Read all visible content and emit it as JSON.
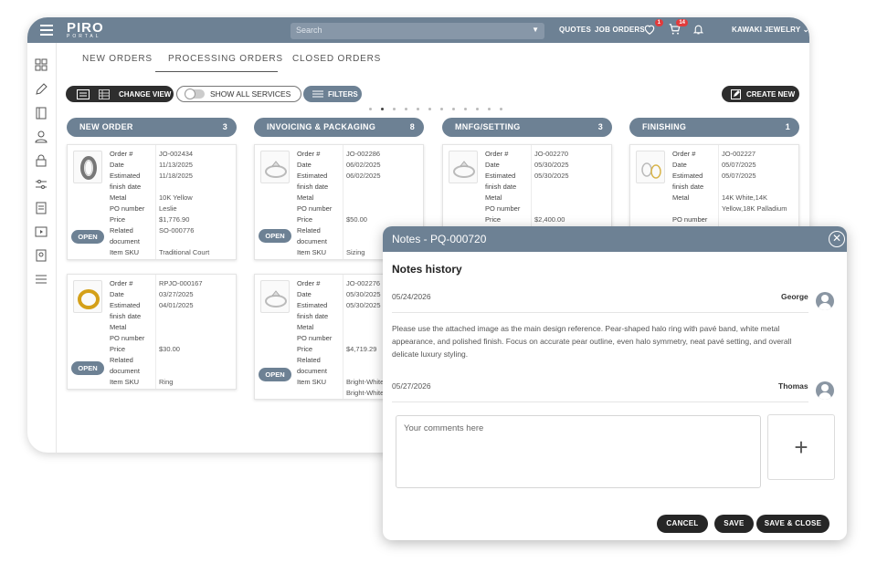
{
  "app": {
    "logo_main": "PIRO",
    "logo_sub": "PORTAL"
  },
  "topbar": {
    "search_placeholder": "Search",
    "nav_quotes": "QUOTES",
    "nav_job_orders": "JOB ORDERS",
    "wishlist_badge": "1",
    "cart_badge": "14",
    "account": "KAWAKI JEWELRY"
  },
  "tabs": [
    "NEW ORDERS",
    "PROCESSING ORDERS",
    "CLOSED ORDERS"
  ],
  "toolbar": {
    "change_view": "CHANGE VIEW",
    "show_all_services": "SHOW ALL SERVICES",
    "filters": "FILTERS",
    "create_new": "CREATE NEW"
  },
  "columns": [
    {
      "title": "NEW ORDER",
      "count": "3"
    },
    {
      "title": "INVOICING & PACKAGING",
      "count": "8"
    },
    {
      "title": "MNFG/SETTING",
      "count": "3"
    },
    {
      "title": "FINISHING",
      "count": "1"
    }
  ],
  "card_labels": {
    "order": "Order #",
    "date": "Date",
    "finish": "Estimated finish date",
    "metal": "Metal",
    "po": "PO number",
    "price": "Price",
    "related": "Related document",
    "sku": "Item SKU",
    "open": "OPEN"
  },
  "cards": {
    "c1": {
      "order": "JO-002434",
      "date": "11/13/2025",
      "finish": "11/18/2025",
      "metal": "10K Yellow",
      "po": "Leslie",
      "price": "$1,776.90",
      "related": "SO-000776",
      "sku": "Traditional Court"
    },
    "c2": {
      "order": "JO-002286",
      "date": "06/02/2025",
      "finish": "06/02/2025",
      "metal": "",
      "po": "",
      "price": "$50.00",
      "related": "",
      "sku": "Sizing"
    },
    "c3": {
      "order": "JO-002270",
      "date": "05/30/2025",
      "finish": "05/30/2025",
      "metal": "",
      "po": "",
      "price": "$2,400.00"
    },
    "c4": {
      "order": "JO-002227",
      "date": "05/07/2025",
      "finish": "05/07/2025",
      "metal": "14K White,14K Yellow,18K Palladium",
      "po": ""
    },
    "c5": {
      "order": "RPJO-000167",
      "date": "03/27/2025",
      "finish": "04/01/2025",
      "metal": "",
      "po": "",
      "price": "$30.00",
      "related": "",
      "sku": "Ring"
    },
    "c6": {
      "order": "JO-002276",
      "date": "05/30/2025",
      "finish": "05/30/2025",
      "metal": "",
      "po": "",
      "price": "$4,719.29",
      "related": "",
      "sku": "Bright-White Bright-White"
    }
  },
  "modal": {
    "title": "Notes - PQ-000720",
    "history_title": "Notes history",
    "note1": {
      "date": "05/24/2026",
      "user": "George",
      "text": "Please use the attached image as the main design reference. Pear-shaped halo ring with pavé band, white metal appearance, and polished finish. Focus on accurate pear outline, even halo symmetry, neat pavé setting, and overall delicate luxury styling."
    },
    "note2": {
      "date": "05/27/2026",
      "user": "Thomas"
    },
    "comment_placeholder": "Your comments here",
    "add": "+",
    "cancel": "CANCEL",
    "save": "SAVE",
    "save_close": "SAVE & CLOSE"
  },
  "colors": {
    "header": "#6d8194",
    "dark": "#262626",
    "badge": "#e23b3b"
  }
}
